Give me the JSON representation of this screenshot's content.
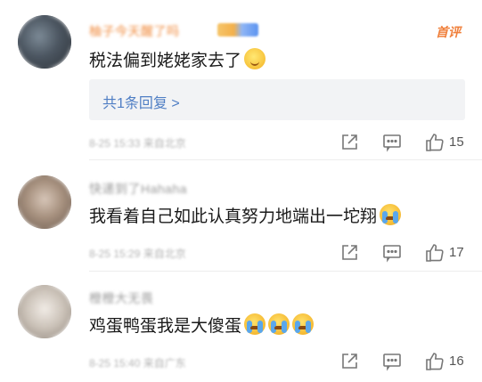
{
  "comments": [
    {
      "author": "柚子今天醒了吗",
      "text": "税法偏到姥姥家去了",
      "emoji": [
        "smile-emoji"
      ],
      "reply_button": "首评",
      "replies_link": "共1条回复 >",
      "meta": "8-25 15:33 来自北京",
      "likes": "15"
    },
    {
      "author": "快递到了Hahaha",
      "text": "我看着自己如此认真努力地端出一坨翔",
      "emoji": [
        "crying-emoji"
      ],
      "meta": "8-25 15:29 来自北京",
      "likes": "17"
    },
    {
      "author": "橙橙大无畏",
      "text": "鸡蛋鸭蛋我是大傻蛋",
      "emoji": [
        "crying-emoji",
        "crying-emoji",
        "crying-emoji"
      ],
      "meta": "8-25 15:40 来自广东",
      "likes": "16"
    }
  ],
  "icons": {
    "share": "share-icon",
    "comment": "comment-icon",
    "like": "like-icon"
  },
  "colors": {
    "vip_name": "#f08a3c",
    "reply_link": "#4f7ec4",
    "accent": "#f0803c"
  }
}
